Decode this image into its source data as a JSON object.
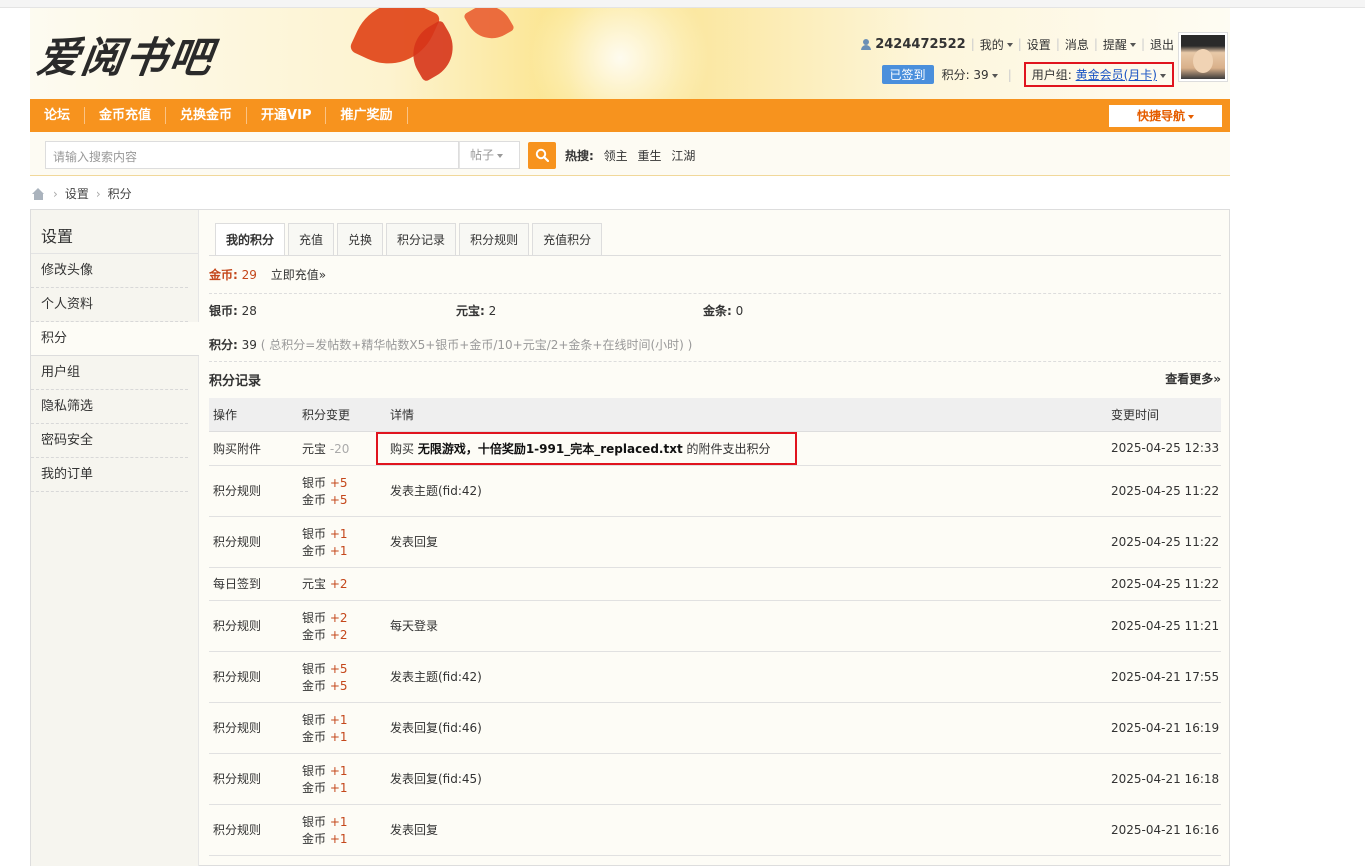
{
  "header": {
    "logo": "爱阅书吧",
    "user_id": "2424472522",
    "menu_my": "我的",
    "menu_settings": "设置",
    "menu_messages": "消息",
    "menu_remind": "提醒",
    "menu_logout": "退出",
    "signed_label": "已签到",
    "points_label": "积分: 39",
    "usergroup_label": "用户组:",
    "usergroup_value": "黄金会员(月卡)"
  },
  "nav": {
    "items": [
      "论坛",
      "金币充值",
      "兑换金币",
      "开通VIP",
      "推广奖励"
    ],
    "quick_nav": "快捷导航"
  },
  "search": {
    "placeholder": "请输入搜索内容",
    "type": "帖子",
    "hot_label": "热搜:",
    "hot_terms": [
      "领主",
      "重生",
      "江湖"
    ]
  },
  "breadcrumb": [
    "设置",
    "积分"
  ],
  "sidebar": {
    "title": "设置",
    "items": [
      "修改头像",
      "个人资料",
      "积分",
      "用户组",
      "隐私筛选",
      "密码安全",
      "我的订单"
    ]
  },
  "tabs": [
    "我的积分",
    "充值",
    "兑换",
    "积分记录",
    "积分规则",
    "充值积分"
  ],
  "credits": {
    "gold_label": "金币:",
    "gold_value": "29",
    "recharge_link": "立即充值»",
    "silver_label": "银币:",
    "silver_value": "28",
    "yuanbao_label": "元宝:",
    "yuanbao_value": "2",
    "jintiao_label": "金条:",
    "jintiao_value": "0",
    "total_label": "积分:",
    "total_value": "39",
    "formula": "( 总积分=发帖数+精华帖数X5+银币+金币/10+元宝/2+金条+在线时间(小时) )"
  },
  "records": {
    "title": "积分记录",
    "more": "查看更多»",
    "columns": [
      "操作",
      "积分变更",
      "详情",
      "变更时间"
    ],
    "rows": [
      {
        "op": "购买附件",
        "changes": [
          {
            "name": "元宝",
            "amt": "-20"
          }
        ],
        "detail_pre": "购买",
        "detail_bold": "无限游戏，十倍奖励1-991_完本_replaced.txt",
        "detail_post": "的附件支出积分",
        "time": "2025-04-25 12:33"
      },
      {
        "op": "积分规则",
        "changes": [
          {
            "name": "银币",
            "amt": "+5"
          },
          {
            "name": "金币",
            "amt": "+5"
          }
        ],
        "detail": "发表主题(fid:42)",
        "time": "2025-04-25 11:22"
      },
      {
        "op": "积分规则",
        "changes": [
          {
            "name": "银币",
            "amt": "+1"
          },
          {
            "name": "金币",
            "amt": "+1"
          }
        ],
        "detail": "发表回复",
        "time": "2025-04-25 11:22"
      },
      {
        "op": "每日签到",
        "changes": [
          {
            "name": "元宝",
            "amt": "+2"
          }
        ],
        "detail": "",
        "time": "2025-04-25 11:22"
      },
      {
        "op": "积分规则",
        "changes": [
          {
            "name": "银币",
            "amt": "+2"
          },
          {
            "name": "金币",
            "amt": "+2"
          }
        ],
        "detail": "每天登录",
        "time": "2025-04-25 11:21"
      },
      {
        "op": "积分规则",
        "changes": [
          {
            "name": "银币",
            "amt": "+5"
          },
          {
            "name": "金币",
            "amt": "+5"
          }
        ],
        "detail": "发表主题(fid:42)",
        "time": "2025-04-21 17:55"
      },
      {
        "op": "积分规则",
        "changes": [
          {
            "name": "银币",
            "amt": "+1"
          },
          {
            "name": "金币",
            "amt": "+1"
          }
        ],
        "detail": "发表回复(fid:46)",
        "time": "2025-04-21 16:19"
      },
      {
        "op": "积分规则",
        "changes": [
          {
            "name": "银币",
            "amt": "+1"
          },
          {
            "name": "金币",
            "amt": "+1"
          }
        ],
        "detail": "发表回复(fid:45)",
        "time": "2025-04-21 16:18"
      },
      {
        "op": "积分规则",
        "changes": [
          {
            "name": "银币",
            "amt": "+1"
          },
          {
            "name": "金币",
            "amt": "+1"
          }
        ],
        "detail": "发表回复",
        "time": "2025-04-21 16:16"
      }
    ]
  }
}
